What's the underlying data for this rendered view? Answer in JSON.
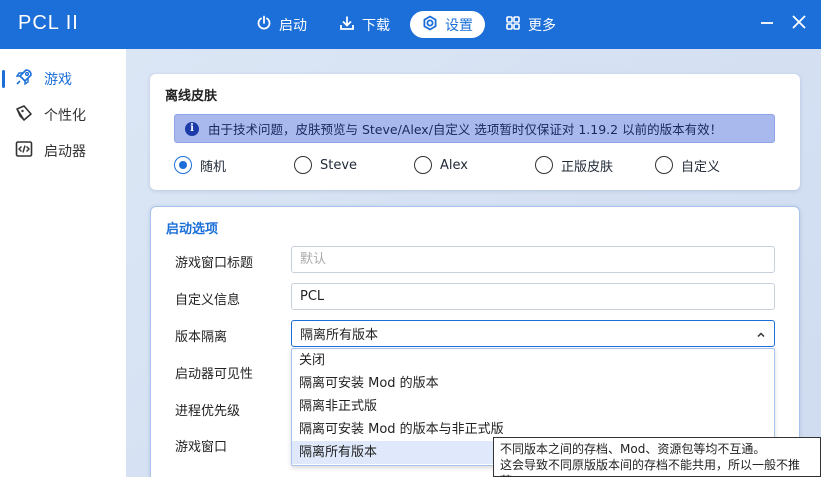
{
  "app": {
    "title": "PCL II"
  },
  "nav": [
    {
      "label": "启动",
      "icon": "power-icon"
    },
    {
      "label": "下载",
      "icon": "download-icon"
    },
    {
      "label": "设置",
      "icon": "gear-icon",
      "active": true
    },
    {
      "label": "更多",
      "icon": "grid-icon"
    }
  ],
  "window": {
    "minimize_icon": "minimize-icon",
    "close_icon": "close-icon"
  },
  "sidebar": {
    "items": [
      {
        "label": "游戏",
        "icon": "rocket-icon",
        "active": true
      },
      {
        "label": "个性化",
        "icon": "brush-icon"
      },
      {
        "label": "启动器",
        "icon": "code-icon"
      }
    ]
  },
  "offline_skin": {
    "title": "离线皮肤",
    "info": "由于技术问题，皮肤预览与 Steve/Alex/自定义 选项暂时仅保证对 1.19.2 以前的版本有效！",
    "options": [
      {
        "label": "随机",
        "checked": true
      },
      {
        "label": "Steve"
      },
      {
        "label": "Alex"
      },
      {
        "label": "正版皮肤"
      },
      {
        "label": "自定义"
      }
    ]
  },
  "launch_options": {
    "title": "启动选项",
    "window_title_label": "游戏窗口标题",
    "window_title_placeholder": "默认",
    "custom_info_label": "自定义信息",
    "custom_info_value": "PCL",
    "isolation_label": "版本隔离",
    "isolation_value": "隔离所有版本",
    "launcher_visibility_label": "启动器可见性",
    "priority_label": "进程优先级",
    "game_window_label": "游戏窗口",
    "isolation_options": [
      "关闭",
      "隔离可安装 Mod 的版本",
      "隔离非正式版",
      "隔离可安装 Mod 的版本与非正式版",
      "隔离所有版本"
    ],
    "selected_index": 4
  },
  "tooltip": {
    "line1": "不同版本之间的存档、Mod、资源包等均不互通。",
    "line2": "这会导致不同原版版本间的存档不能共用，所以一般不推荐。"
  },
  "colors": {
    "accent": "#1c6fd8",
    "info_bg": "#a9b9ee"
  }
}
